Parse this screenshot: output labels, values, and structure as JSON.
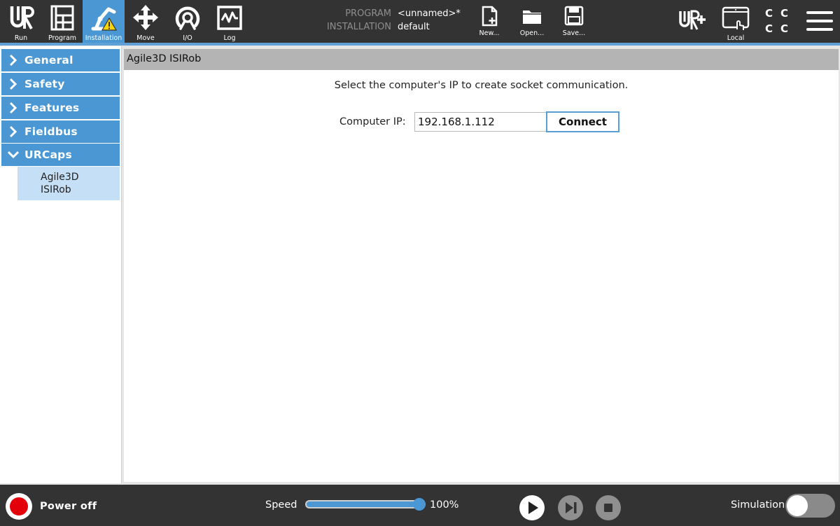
{
  "top_tabs": [
    {
      "label": "Run",
      "icon": "ur-logo-icon"
    },
    {
      "label": "Program",
      "icon": "program-icon"
    },
    {
      "label": "Installation",
      "icon": "installation-warning-icon"
    },
    {
      "label": "Move",
      "icon": "move-arrows-icon"
    },
    {
      "label": "I/O",
      "icon": "io-icon"
    },
    {
      "label": "Log",
      "icon": "log-icon"
    }
  ],
  "program_info": {
    "program_label": "PROGRAM",
    "program_value": "<unnamed>*",
    "installation_label": "INSTALLATION",
    "installation_value": "default"
  },
  "file_buttons": [
    {
      "label": "New...",
      "icon": "new-file-icon"
    },
    {
      "label": "Open...",
      "icon": "open-folder-icon"
    },
    {
      "label": "Save...",
      "icon": "save-disk-icon"
    }
  ],
  "right_header": {
    "local_label": "Local",
    "cc_row1": "CC",
    "cc_row2": "CC"
  },
  "sidebar": {
    "items": [
      {
        "label": "General",
        "expanded": false
      },
      {
        "label": "Safety",
        "expanded": false
      },
      {
        "label": "Features",
        "expanded": false
      },
      {
        "label": "Fieldbus",
        "expanded": false
      },
      {
        "label": "URCaps",
        "expanded": true
      }
    ],
    "sub_item": {
      "label": "Agile3D ISIRob"
    }
  },
  "panel": {
    "title": "Agile3D ISIRob",
    "description": "Select the computer's IP to create socket communication.",
    "ip_label": "Computer IP:",
    "ip_value": "192.168.1.112",
    "connect_label": "Connect"
  },
  "bottom": {
    "power_label": "Power off",
    "speed_label": "Speed",
    "speed_value": "100%",
    "speed_fraction": 1.0,
    "simulation_label": "Simulation",
    "simulation_on": false
  },
  "colors": {
    "accent": "#4a97d3",
    "topbar": "#333333",
    "power_red": "#e3000b",
    "selected_sub": "#c5e0f6"
  }
}
